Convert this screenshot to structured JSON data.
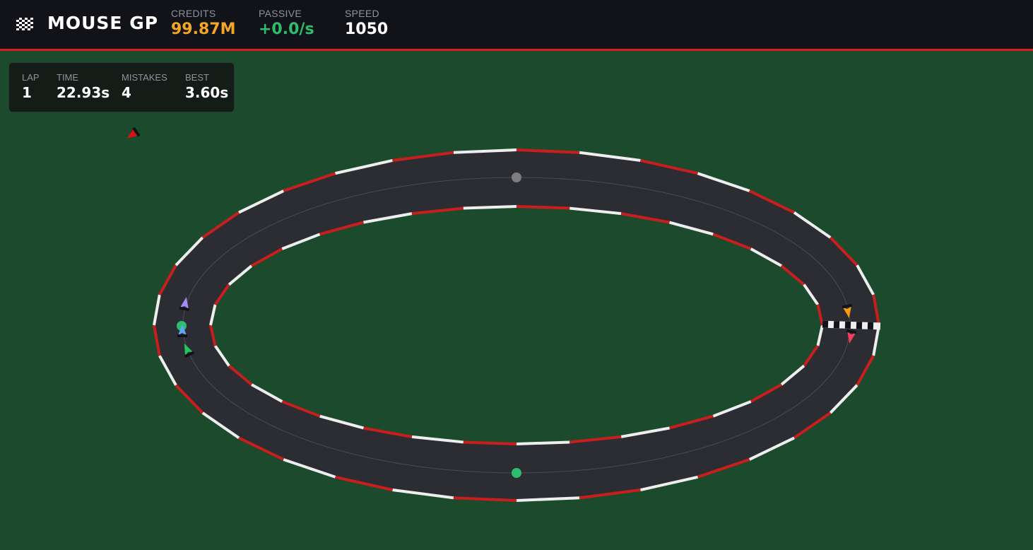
{
  "header": {
    "title": "MOUSE GP",
    "logo_icon": "checkered-flag-icon",
    "stats": {
      "credits": {
        "label": "CREDITS",
        "value": "99.87M",
        "color": "#f5a623"
      },
      "passive": {
        "label": "PASSIVE",
        "value": "+0.0/s",
        "color": "#2ebd6e"
      },
      "speed": {
        "label": "SPEED",
        "value": "1050",
        "color": "#ffffff"
      }
    }
  },
  "hud": {
    "lap": {
      "label": "LAP",
      "value": "1"
    },
    "time": {
      "label": "TIME",
      "value": "22.93s"
    },
    "mistakes": {
      "label": "MISTAKES",
      "value": "4"
    },
    "best": {
      "label": "BEST",
      "value": "3.60s"
    }
  },
  "colors": {
    "grass": "#1c4a2c",
    "asphalt": "#2b2d33",
    "kerb_red": "#c81e1e",
    "kerb_white": "#eeeeee",
    "accent": "#d41e1e"
  },
  "cars": [
    {
      "name": "player-cursor-car",
      "color": "#e01010"
    },
    {
      "name": "purple-car",
      "color": "#a78bfa"
    },
    {
      "name": "blue-car",
      "color": "#60a5fa"
    },
    {
      "name": "green-car",
      "color": "#22c55e"
    },
    {
      "name": "orange-car",
      "color": "#f59e0b"
    },
    {
      "name": "pink-car",
      "color": "#f43f5e"
    }
  ],
  "checkpoints": [
    {
      "name": "checkpoint-top",
      "color": "#7d7d82"
    },
    {
      "name": "checkpoint-left",
      "color": "#2ebd6e"
    },
    {
      "name": "checkpoint-bottom",
      "color": "#2ebd6e"
    }
  ]
}
